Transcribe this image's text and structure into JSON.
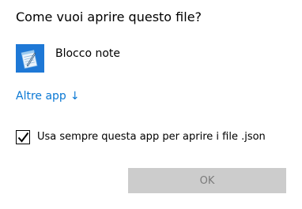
{
  "dialog": {
    "title": "Come vuoi aprire questo file?",
    "app": {
      "name": "Blocco note",
      "icon": "notepad-icon",
      "icon_bg": "#1e78d6"
    },
    "more_apps": {
      "label": "Altre app",
      "arrow": "↓",
      "color": "#0a78d4"
    },
    "always_use": {
      "label": "Usa sempre questa app per aprire i file .json",
      "checked": true
    },
    "ok_button": {
      "label": "OK",
      "enabled": false
    }
  }
}
